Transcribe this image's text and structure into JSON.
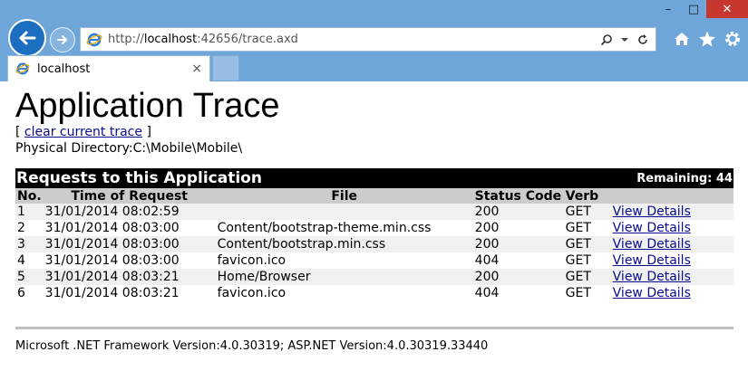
{
  "window": {
    "minimize": "–",
    "maximize": "□",
    "close": "✕"
  },
  "browser": {
    "address": {
      "prefix": "http://",
      "host": "localhost",
      "path": ":42656/trace.axd"
    },
    "tab": {
      "label": "localhost",
      "close": "×"
    }
  },
  "page": {
    "title": "Application Trace",
    "clear_open": "[ ",
    "clear_link": "clear current trace",
    "clear_close": " ]",
    "physical_directory": "Physical Directory:C:\\Mobile\\Mobile\\",
    "requests_title": "Requests to this Application",
    "remaining": "Remaining: 44",
    "columns": {
      "no": "No.",
      "time": "Time of Request",
      "file": "File",
      "status": "Status Code",
      "verb": "Verb"
    },
    "rows": [
      {
        "no": "1",
        "time": "31/01/2014 08:02:59",
        "file": "",
        "status": "200",
        "verb": "GET",
        "action": "View Details"
      },
      {
        "no": "2",
        "time": "31/01/2014 08:03:00",
        "file": "Content/bootstrap-theme.min.css",
        "status": "200",
        "verb": "GET",
        "action": "View Details"
      },
      {
        "no": "3",
        "time": "31/01/2014 08:03:00",
        "file": "Content/bootstrap.min.css",
        "status": "200",
        "verb": "GET",
        "action": "View Details"
      },
      {
        "no": "4",
        "time": "31/01/2014 08:03:00",
        "file": "favicon.ico",
        "status": "404",
        "verb": "GET",
        "action": "View Details"
      },
      {
        "no": "5",
        "time": "31/01/2014 08:03:21",
        "file": "Home/Browser",
        "status": "200",
        "verb": "GET",
        "action": "View Details"
      },
      {
        "no": "6",
        "time": "31/01/2014 08:03:21",
        "file": "favicon.ico",
        "status": "404",
        "verb": "GET",
        "action": "View Details"
      }
    ],
    "footer": "Microsoft .NET Framework Version:4.0.30319; ASP.NET Version:4.0.30319.33440"
  },
  "icons": {
    "back": "back-arrow-icon",
    "forward": "forward-arrow-icon",
    "ie_favicon": "internet-explorer-icon",
    "search": "search-icon",
    "dropdown": "chevron-down-icon",
    "refresh": "refresh-icon",
    "home": "home-icon",
    "favorites": "star-icon",
    "tools": "gear-icon"
  },
  "colors": {
    "chrome": "#6fa6d9",
    "back_button": "#1b6ec0",
    "close_button": "#c7372f",
    "link": "#0a0a8f",
    "header_bar": "#000000",
    "column_header": "#cccccc",
    "alt_row": "#f0f0f0"
  }
}
